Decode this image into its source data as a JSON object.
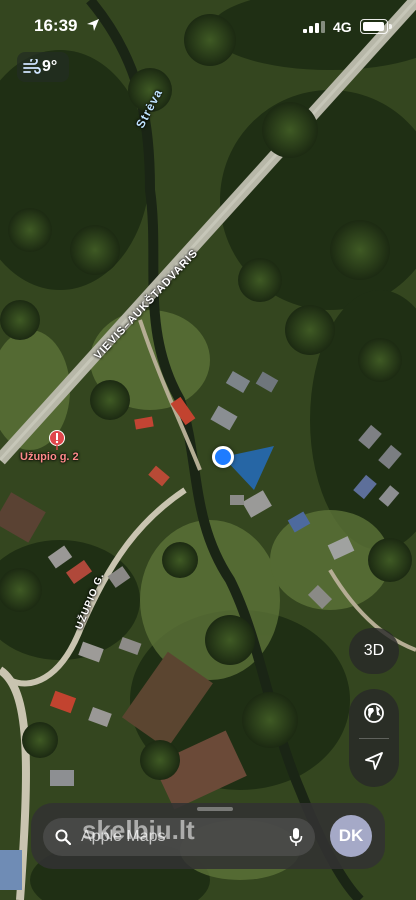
{
  "status_bar": {
    "time": "16:39",
    "network": "4G",
    "battery_level": 0.95,
    "location_icon": "location-arrow-icon"
  },
  "weather": {
    "icon": "wind-icon",
    "temperature": "9°"
  },
  "map": {
    "type": "satellite",
    "labels": {
      "main_road": "VIEVIS–AUKŠTADVARIS",
      "river": "Strėva",
      "side_street": "UŽUPIO G."
    },
    "pin": {
      "label": "Užupio g. 2",
      "color": "#e0474c"
    },
    "user_location": {
      "color": "#1e7cff"
    }
  },
  "controls": {
    "three_d_label": "3D",
    "globe_icon": "globe-icon",
    "locate_icon": "location-arrow-icon"
  },
  "search_sheet": {
    "placeholder": "Apple Maps",
    "avatar_initials": "DK"
  },
  "watermark": "skelbiu.lt"
}
